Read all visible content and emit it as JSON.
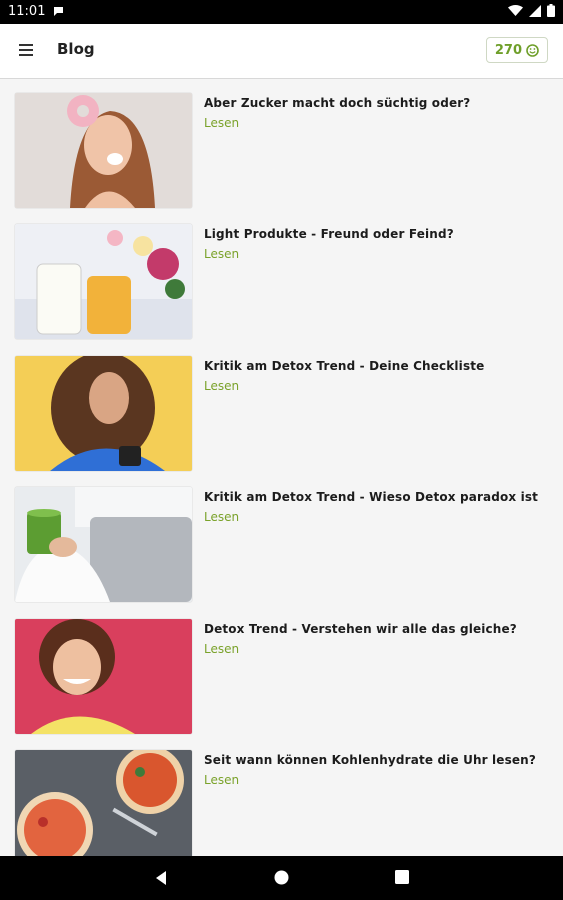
{
  "status_bar": {
    "time": "11:01",
    "icons": [
      "chat-notification-icon",
      "wifi-icon",
      "signal-icon",
      "battery-icon"
    ]
  },
  "app_bar": {
    "title": "Blog",
    "points": "270",
    "menu_icon": "hamburger-menu-icon",
    "points_icon": "smiley-icon"
  },
  "colors": {
    "accent_green": "#7aa22a",
    "background": "#f5f5f5",
    "appbar": "#ffffff"
  },
  "posts": [
    {
      "title": "Aber Zucker macht doch süchtig oder?",
      "link": "Lesen"
    },
    {
      "title": "Light Produkte - Freund oder Feind?",
      "link": "Lesen"
    },
    {
      "title": "Kritik am Detox Trend - Deine Checkliste",
      "link": "Lesen"
    },
    {
      "title": "Kritik am Detox Trend - Wieso Detox paradox ist",
      "link": "Lesen"
    },
    {
      "title": "Detox Trend - Verstehen wir alle das gleiche?",
      "link": "Lesen"
    },
    {
      "title": "Seit wann können Kohlenhydrate die Uhr lesen?",
      "link": "Lesen"
    }
  ],
  "nav_bar": {
    "icons": [
      "back-icon",
      "home-icon",
      "recents-icon"
    ]
  }
}
